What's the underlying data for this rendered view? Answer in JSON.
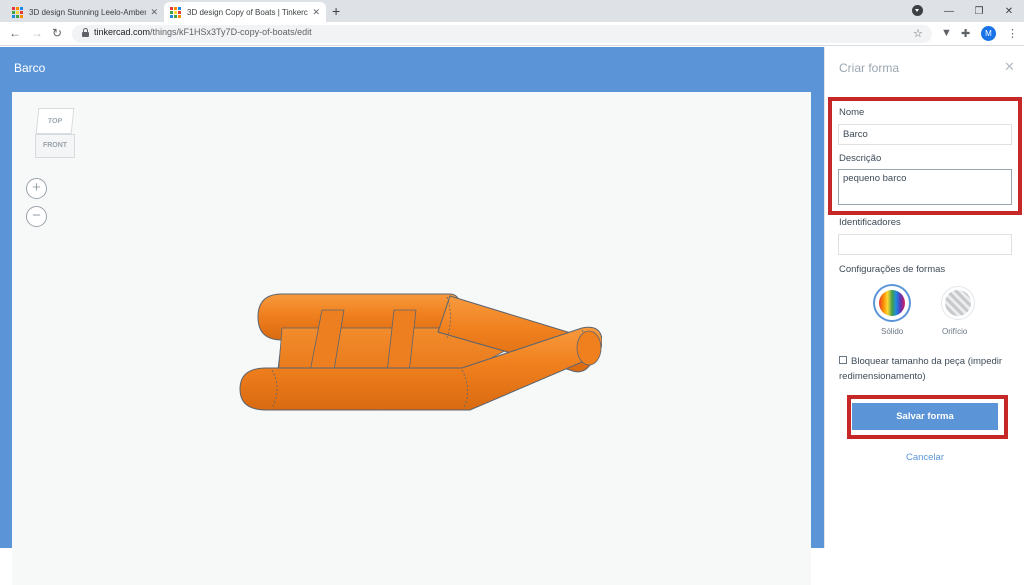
{
  "browser": {
    "tabs": [
      {
        "title": "3D design Stunning Leelo-Amber",
        "active": false
      },
      {
        "title": "3D design Copy of Boats | Tinkercad",
        "active": true
      }
    ],
    "new_tab": "+",
    "window_controls": {
      "minimize": "—",
      "maximize": "❐",
      "close": "✕"
    },
    "url_host": "tinkercad.com",
    "url_path": "/things/kF1HSx3Ty7D-copy-of-boats/edit",
    "avatar_initial": "M"
  },
  "workspace": {
    "design_name": "Barco",
    "viewcube": {
      "top": "TOP",
      "front": "FRONT"
    },
    "zoom_in": "+",
    "zoom_out": "−",
    "boat_color": "#f0801e",
    "background_color": "#5b95d8"
  },
  "panel": {
    "title": "Criar forma",
    "close": "✕",
    "name_label": "Nome",
    "name_value": "Barco",
    "description_label": "Descrição",
    "description_value": "pequeno barco",
    "tags_label": "Identificadores",
    "tags_value": "",
    "shape_settings_label": "Configurações de formas",
    "solid_label": "Sólido",
    "hole_label": "Orifício",
    "lock_label": "Bloquear tamanho da peça (impedir redimensionamento)",
    "save_label": "Salvar forma",
    "cancel_label": "Cancelar",
    "highlight_color": "#c62828"
  }
}
